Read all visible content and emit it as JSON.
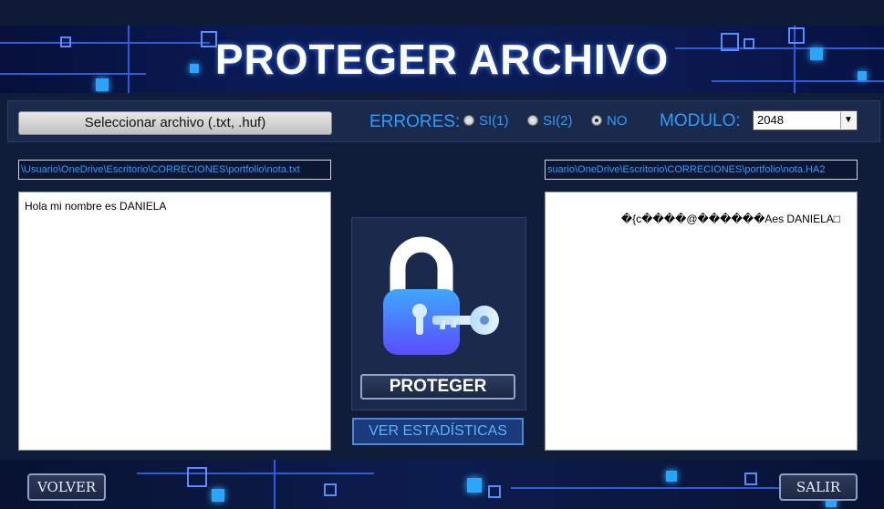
{
  "header": {
    "title": "PROTEGER ARCHIVO"
  },
  "toolbar": {
    "select_file_label": "Seleccionar archivo (.txt, .huf)",
    "errors_label": "ERRORES:",
    "options": [
      {
        "label": "SI(1)",
        "selected": false
      },
      {
        "label": "SI(2)",
        "selected": false
      },
      {
        "label": "NO",
        "selected": true
      }
    ],
    "module_label": "MODULO:",
    "module_value": "2048"
  },
  "input_path": "\\Usuario\\OneDrive\\Escritorio\\CORRECIONES\\portfolio\\nota.txt",
  "output_path": "suario\\OneDrive\\Escritorio\\CORRECIONES\\portfolio\\nota.HA2",
  "input_text": "Hola mi nombre es DANIELA",
  "output_text": "�{c����@������Aes DANIELA□",
  "buttons": {
    "protect": "PROTEGER",
    "stats": "VER ESTADÍSTICAS",
    "back": "VOLVER",
    "exit": "SALIR"
  },
  "colors": {
    "accent": "#2f9bff",
    "background": "#0f1c3a"
  }
}
